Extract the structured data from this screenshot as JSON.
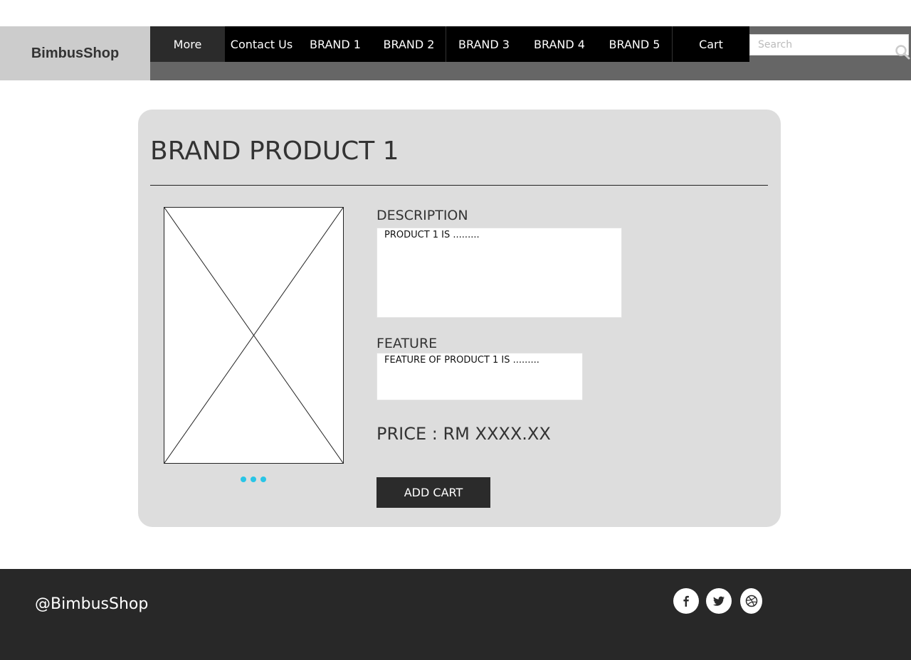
{
  "header": {
    "logo": "BimbusShop",
    "nav": [
      {
        "label": "More"
      },
      {
        "label": "Contact Us"
      },
      {
        "label": "BRAND 1"
      },
      {
        "label": "BRAND 2"
      },
      {
        "label": "BRAND 3"
      },
      {
        "label": "BRAND 4"
      },
      {
        "label": "BRAND 5"
      },
      {
        "label": "Cart"
      }
    ],
    "search": {
      "placeholder": "Search",
      "value": "",
      "icon": "search-icon"
    }
  },
  "product": {
    "title": "BRAND PRODUCT 1",
    "image_icon": "image-placeholder-icon",
    "carousel_dots": 3,
    "description_label": "DESCRIPTION",
    "description_text": "PRODUCT 1 IS .........",
    "feature_label": "FEATURE",
    "feature_text": "FEATURE OF PRODUCT 1 IS .........",
    "price": "PRICE : RM XXXX.XX",
    "add_cart_label": "ADD CART"
  },
  "footer": {
    "handle": "@BimbusShop",
    "social_icons": [
      "facebook-icon",
      "twitter-icon",
      "dribbble-icon"
    ]
  },
  "colors": {
    "header_bar": "#666666",
    "logo_bg": "#cccccc",
    "nav_bg": "#000000",
    "panel_bg": "#dddddd",
    "button_bg": "#2b2b2b",
    "footer_bg": "#282828",
    "dot_accent": "#29c5e6"
  }
}
